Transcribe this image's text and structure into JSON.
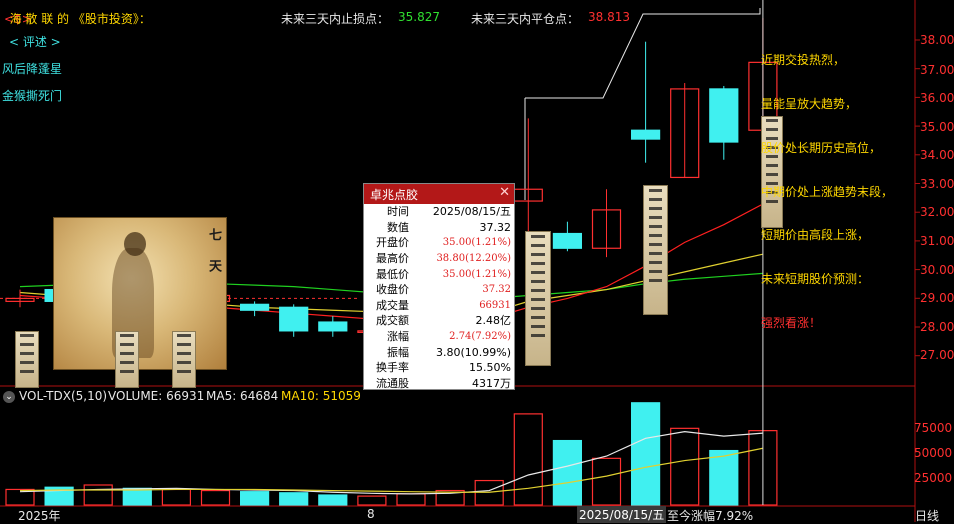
{
  "header": {
    "title_tag": "<$>",
    "title_name": "海 散 联",
    "title_suffix": "的 《股市投资》：",
    "stop_loss_label": "未来三天内止损点：",
    "stop_loss_value": "35.827",
    "flat_label": "未来三天内平仓点：",
    "flat_value": "38.813"
  },
  "left_panel": {
    "review_label": "< 评述 >",
    "line1": "风后降蓬星",
    "line2": "金猴撕死门"
  },
  "fairy_caption": "七天",
  "annotations": [
    "近期交投热烈，",
    "量能呈放大趋势，",
    "股价处长期历史高位，",
    "中期价处上涨趋势末段，",
    "短期价由高段上涨，",
    "未来短期股价预测：",
    "强烈看涨！"
  ],
  "popup": {
    "title": "卓兆点胶",
    "close_icon": "close-icon",
    "rows": [
      {
        "k": "时间",
        "v": "2025/08/15/五",
        "red": false
      },
      {
        "k": "数值",
        "v": "37.32",
        "red": false
      },
      {
        "k": "开盘价",
        "v": "35.00(1.21%)",
        "red": true
      },
      {
        "k": "最高价",
        "v": "38.80(12.20%)",
        "red": true
      },
      {
        "k": "最低价",
        "v": "35.00(1.21%)",
        "red": true
      },
      {
        "k": "收盘价",
        "v": "37.32",
        "red": true
      },
      {
        "k": "成交量",
        "v": "66931",
        "red": true
      },
      {
        "k": "成交额",
        "v": "2.48亿",
        "red": false
      },
      {
        "k": "涨幅",
        "v": "2.74(7.92%)",
        "red": true
      },
      {
        "k": "振幅",
        "v": "3.80(10.99%)",
        "red": false
      },
      {
        "k": "换手率",
        "v": "15.50%",
        "red": false
      },
      {
        "k": "流通股",
        "v": "4317万",
        "red": false
      }
    ]
  },
  "price_axis": [
    "38.00",
    "37.00",
    "36.00",
    "35.00",
    "34.00",
    "33.00",
    "32.00",
    "31.00",
    "30.00",
    "29.00",
    "28.00",
    "27.00"
  ],
  "volume_bar": {
    "collapse_icon": "chevron-down-icon",
    "indicator": "VOL-TDX(5,10)",
    "volume_label": "VOLUME: 66931",
    "ma5_label": "MA5: 64684",
    "ma10_label": "MA10: 51059"
  },
  "volume_axis": [
    "75000",
    "50000",
    "25000"
  ],
  "bottom_axis": {
    "year": "2025年",
    "month": "8",
    "cursor_date": "2025/08/15/五",
    "cursor_change": "至今涨幅7.92%",
    "period": "日线"
  },
  "colors": {
    "up": "#ff3030",
    "down": "#40f0f0",
    "ma_white": "#e8e8e8",
    "ma_yellow": "#e0d030",
    "ma_green": "#20d020",
    "ma_red": "#ff2020"
  },
  "chart_data": {
    "type": "candlestick",
    "price_range": [
      26.4,
      38.6
    ],
    "volume_range": [
      0,
      90000
    ],
    "candles": [
      {
        "o": 29.2,
        "c": 29.3,
        "h": 29.6,
        "l": 29.0,
        "v": 14000
      },
      {
        "o": 29.6,
        "c": 29.2,
        "h": 29.7,
        "l": 28.9,
        "v": 16000
      },
      {
        "o": 29.1,
        "c": 29.4,
        "h": 29.6,
        "l": 28.9,
        "v": 18000
      },
      {
        "o": 29.0,
        "c": 28.6,
        "h": 29.1,
        "l": 28.4,
        "v": 15000
      },
      {
        "o": 29.1,
        "c": 29.2,
        "h": 29.5,
        "l": 28.8,
        "v": 14000
      },
      {
        "o": 29.2,
        "c": 29.4,
        "h": 29.6,
        "l": 29.0,
        "v": 13000
      },
      {
        "o": 29.1,
        "c": 28.9,
        "h": 29.2,
        "l": 28.7,
        "v": 12000
      },
      {
        "o": 29.0,
        "c": 28.2,
        "h": 29.1,
        "l": 28.0,
        "v": 11000
      },
      {
        "o": 28.5,
        "c": 28.2,
        "h": 28.7,
        "l": 28.0,
        "v": 9000
      },
      {
        "o": 28.2,
        "c": 28.2,
        "h": 28.4,
        "l": 28.0,
        "v": 8000
      },
      {
        "o": 28.3,
        "c": 28.4,
        "h": 28.6,
        "l": 28.2,
        "v": 10000
      },
      {
        "o": 28.5,
        "c": 28.6,
        "h": 28.8,
        "l": 28.3,
        "v": 13000
      },
      {
        "o": 28.8,
        "c": 29.5,
        "h": 29.9,
        "l": 28.6,
        "v": 22000
      },
      {
        "o": 32.6,
        "c": 33.0,
        "h": 35.4,
        "l": 29.5,
        "v": 82000
      },
      {
        "o": 31.5,
        "c": 31.0,
        "h": 31.9,
        "l": 30.9,
        "v": 58000
      },
      {
        "o": 31.0,
        "c": 32.3,
        "h": 33.0,
        "l": 30.7,
        "v": 42000
      },
      {
        "o": 35.0,
        "c": 34.7,
        "h": 38.0,
        "l": 33.9,
        "v": 92000
      },
      {
        "o": 33.4,
        "c": 36.4,
        "h": 36.6,
        "l": 33.4,
        "v": 69000
      },
      {
        "o": 36.4,
        "c": 34.6,
        "h": 36.5,
        "l": 34.0,
        "v": 49000
      },
      {
        "o": 35.0,
        "c": 37.3,
        "h": 38.8,
        "l": 35.0,
        "v": 66931
      }
    ],
    "ma_green": [
      29.7,
      29.75,
      29.8,
      29.8,
      29.8,
      29.8,
      29.75,
      29.7,
      29.6,
      29.5,
      29.4,
      29.35,
      29.3,
      29.4,
      29.5,
      29.6,
      29.8,
      29.95,
      30.05,
      30.15
    ],
    "ma_yellow": [
      29.5,
      29.4,
      29.35,
      29.3,
      29.2,
      29.1,
      29.0,
      28.95,
      28.9,
      28.85,
      28.8,
      28.8,
      28.8,
      29.2,
      29.4,
      29.6,
      29.9,
      30.2,
      30.5,
      30.8
    ],
    "ma_red": [
      29.4,
      29.3,
      29.2,
      29.1,
      29.1,
      29.0,
      28.9,
      28.8,
      28.7,
      28.6,
      28.5,
      28.4,
      28.6,
      29.0,
      29.3,
      29.7,
      30.4,
      31.2,
      31.8,
      32.5
    ],
    "ma_white": [
      29.3,
      29.3,
      29.3,
      29.2,
      29.1,
      29.0,
      28.9,
      28.8,
      28.6,
      28.5,
      28.4,
      28.5,
      29.0,
      29.8,
      30.5,
      31.5,
      35.9,
      35.9,
      36.8,
      37.6
    ],
    "vol_ma_white": [
      12000,
      13000,
      14000,
      14500,
      15000,
      14000,
      13500,
      13000,
      11500,
      10500,
      10000,
      10500,
      13000,
      27000,
      35000,
      44000,
      60000,
      66000,
      62000,
      64684
    ],
    "vol_ma_yellow": [
      13000,
      13500,
      13500,
      13500,
      14000,
      14000,
      14000,
      13500,
      13000,
      12500,
      12000,
      11500,
      11500,
      15000,
      20000,
      26000,
      34000,
      40000,
      44000,
      51059
    ]
  }
}
